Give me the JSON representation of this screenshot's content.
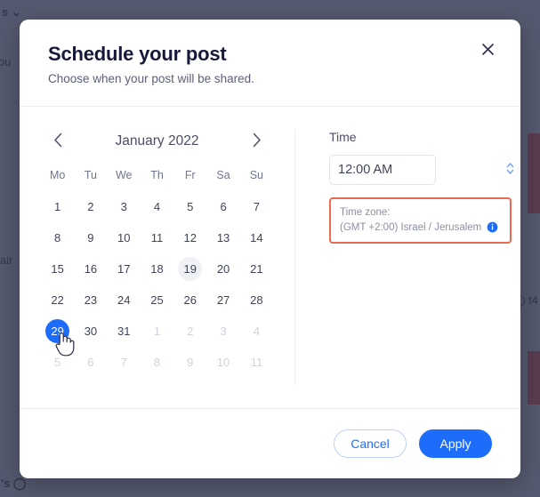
{
  "background": {
    "fragments": [
      "s ⌄",
      "ou",
      "air",
      "'s ◯",
      "◯ t4"
    ]
  },
  "modal": {
    "title": "Schedule your post",
    "subtitle": "Choose when your post will be shared.",
    "close_label": "×",
    "close_icon": "close-icon"
  },
  "calendar": {
    "month_label": "January 2022",
    "prev_icon": "chevron-left-icon",
    "next_icon": "chevron-right-icon",
    "weekdays": [
      "Mo",
      "Tu",
      "We",
      "Th",
      "Fr",
      "Sa",
      "Su"
    ],
    "selected_day": 29,
    "today_day": 19,
    "cursor_icon": "pointing-hand-cursor",
    "cells": [
      {
        "label": "1",
        "state": "normal"
      },
      {
        "label": "2",
        "state": "normal"
      },
      {
        "label": "3",
        "state": "normal"
      },
      {
        "label": "4",
        "state": "normal"
      },
      {
        "label": "5",
        "state": "normal"
      },
      {
        "label": "6",
        "state": "normal"
      },
      {
        "label": "7",
        "state": "normal"
      },
      {
        "label": "8",
        "state": "normal"
      },
      {
        "label": "9",
        "state": "normal"
      },
      {
        "label": "10",
        "state": "normal"
      },
      {
        "label": "11",
        "state": "normal"
      },
      {
        "label": "12",
        "state": "normal"
      },
      {
        "label": "13",
        "state": "normal"
      },
      {
        "label": "14",
        "state": "normal"
      },
      {
        "label": "15",
        "state": "normal"
      },
      {
        "label": "16",
        "state": "normal"
      },
      {
        "label": "17",
        "state": "normal"
      },
      {
        "label": "18",
        "state": "normal"
      },
      {
        "label": "19",
        "state": "today"
      },
      {
        "label": "20",
        "state": "normal"
      },
      {
        "label": "21",
        "state": "normal"
      },
      {
        "label": "22",
        "state": "normal"
      },
      {
        "label": "23",
        "state": "normal"
      },
      {
        "label": "24",
        "state": "normal"
      },
      {
        "label": "25",
        "state": "normal"
      },
      {
        "label": "26",
        "state": "normal"
      },
      {
        "label": "27",
        "state": "normal"
      },
      {
        "label": "28",
        "state": "normal"
      },
      {
        "label": "29",
        "state": "selected"
      },
      {
        "label": "30",
        "state": "normal"
      },
      {
        "label": "31",
        "state": "normal"
      },
      {
        "label": "1",
        "state": "muted"
      },
      {
        "label": "2",
        "state": "muted"
      },
      {
        "label": "3",
        "state": "muted"
      },
      {
        "label": "4",
        "state": "muted"
      },
      {
        "label": "5",
        "state": "muted"
      },
      {
        "label": "6",
        "state": "muted"
      },
      {
        "label": "7",
        "state": "muted"
      },
      {
        "label": "8",
        "state": "muted"
      },
      {
        "label": "9",
        "state": "muted"
      },
      {
        "label": "10",
        "state": "muted"
      },
      {
        "label": "11",
        "state": "muted"
      }
    ]
  },
  "time": {
    "label": "Time",
    "value": "12:00 AM",
    "placeholder": "12:00 AM",
    "stepper_icon": "stepper-up-down-icon",
    "timezone_title": "Time zone:",
    "timezone_value": "(GMT +2:00) Israel / Jerusalem",
    "info_icon": "info-circle-icon"
  },
  "footer": {
    "cancel_label": "Cancel",
    "apply_label": "Apply"
  },
  "colors": {
    "accent": "#1e6dfa",
    "highlight_border": "#ec6a50",
    "title": "#17193b",
    "muted_text": "#8b8fa3"
  }
}
